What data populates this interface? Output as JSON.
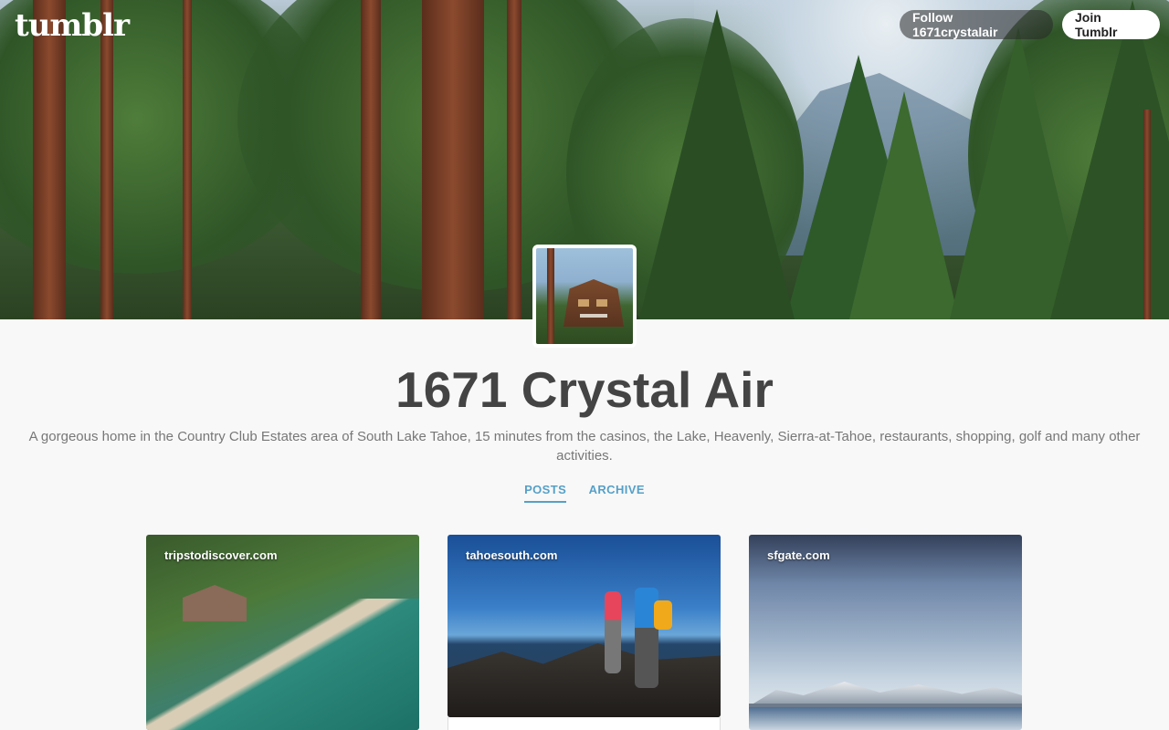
{
  "header": {
    "logo_text": "tumblr",
    "follow_label": "Follow 1671crystalair",
    "join_label": "Join Tumblr"
  },
  "blog": {
    "title": "1671 Crystal Air",
    "description": "A gorgeous home in the Country Club Estates area of South Lake Tahoe, 15 minutes from the casinos, the Lake, Heavenly, Sierra-at-Tahoe, restaurants, shopping, golf and many other activities."
  },
  "nav": {
    "tabs": [
      {
        "label": "POSTS",
        "active": true
      },
      {
        "label": "ARCHIVE",
        "active": false
      }
    ]
  },
  "posts": [
    {
      "source": "tripstodiscover.com"
    },
    {
      "source": "tahoesouth.com"
    },
    {
      "source": "sfgate.com"
    }
  ],
  "colors": {
    "accent": "#56a0c7",
    "title": "#444444",
    "description": "#777777",
    "background": "#f8f8f8"
  }
}
